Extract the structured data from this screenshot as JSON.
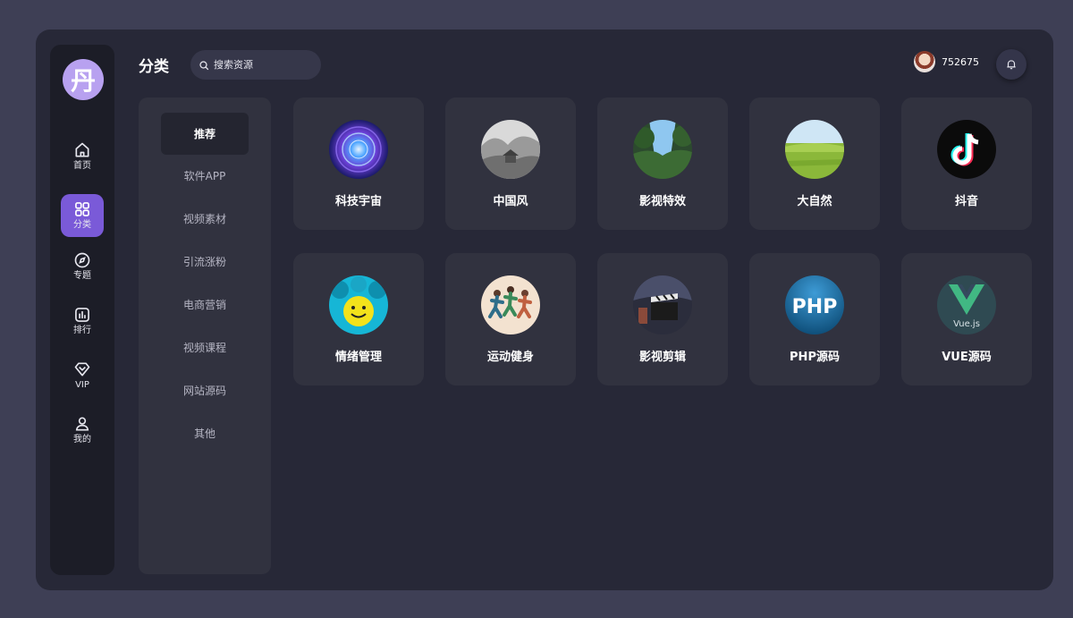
{
  "logo": {
    "char": "丹"
  },
  "nav": [
    {
      "label": "首页",
      "icon": "home-icon"
    },
    {
      "label": "分类",
      "icon": "grid-icon",
      "active": true
    },
    {
      "label": "专题",
      "icon": "compass-icon"
    },
    {
      "label": "排行",
      "icon": "bar-chart-icon"
    },
    {
      "label": "VIP",
      "icon": "diamond-icon"
    },
    {
      "label": "我的",
      "icon": "user-icon"
    }
  ],
  "header": {
    "title": "分类",
    "search_placeholder": "搜索资源",
    "username": "752675"
  },
  "categories": [
    {
      "label": "推荐",
      "active": true
    },
    {
      "label": "软件APP"
    },
    {
      "label": "视频素材"
    },
    {
      "label": "引流涨粉"
    },
    {
      "label": "电商营销"
    },
    {
      "label": "视频课程"
    },
    {
      "label": "网站源码"
    },
    {
      "label": "其他"
    }
  ],
  "cards": [
    {
      "title": "科技宇宙",
      "icon": "tech-universe-thumb"
    },
    {
      "title": "中国风",
      "icon": "chinese-style-thumb"
    },
    {
      "title": "影视特效",
      "icon": "vfx-thumb"
    },
    {
      "title": "大自然",
      "icon": "nature-thumb"
    },
    {
      "title": "抖音",
      "icon": "douyin-logo"
    },
    {
      "title": "情绪管理",
      "icon": "emotion-thumb"
    },
    {
      "title": "运动健身",
      "icon": "fitness-thumb"
    },
    {
      "title": "影视剪辑",
      "icon": "film-editing-thumb"
    },
    {
      "title": "PHP源码",
      "icon": "php-logo",
      "logo_text": "PHP"
    },
    {
      "title": "VUE源码",
      "icon": "vue-logo",
      "logo_text": "Vue.js"
    }
  ],
  "colors": {
    "accent": "#7a5ad8",
    "background": "#272837",
    "card": "#31323f"
  }
}
